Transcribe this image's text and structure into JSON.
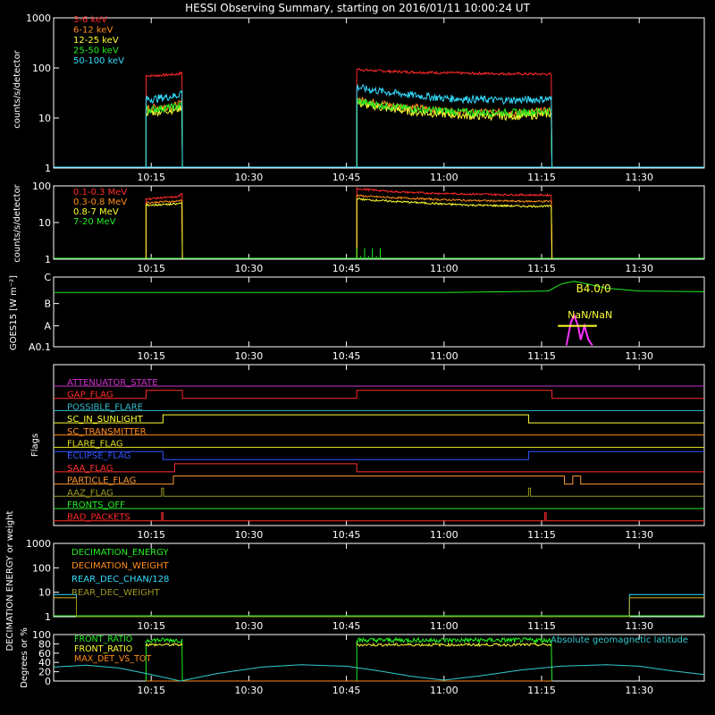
{
  "title": "HESSI Observing Summary, starting on 2016/01/11 10:00:24 UT",
  "x_tick_labels": [
    "10:15",
    "10:30",
    "10:45",
    "11:00",
    "11:15",
    "11:30"
  ],
  "chart_data": [
    {
      "type": "line",
      "ylabel": "counts/s/detector",
      "yscale": "log",
      "ylim": [
        1,
        1000
      ],
      "y_tick_labels": [
        "1",
        "10",
        "100",
        "1000"
      ],
      "x_unit": "minutes after 10:00 UT",
      "intervals": [
        [
          14.2,
          19.8
        ],
        [
          46.6,
          76.6
        ]
      ],
      "series": [
        {
          "name": "3-6 keV",
          "color": "#ff2a2a",
          "x": [
            14.2,
            15,
            17,
            19,
            19.8,
            46.6,
            48,
            52,
            56,
            60,
            64,
            68,
            72,
            76,
            76.6
          ],
          "y": [
            70,
            70,
            72,
            75,
            80,
            95,
            90,
            85,
            82,
            80,
            78,
            77,
            76,
            75,
            75
          ]
        },
        {
          "name": "6-12 keV",
          "color": "#ff8c1a",
          "x": [
            14.2,
            15,
            17,
            19,
            19.8,
            46.6,
            48,
            52,
            56,
            60,
            64,
            68,
            72,
            76,
            76.6
          ],
          "y": [
            16,
            16,
            17,
            18,
            21,
            24,
            22,
            18,
            16,
            14,
            13,
            13,
            13,
            14,
            14
          ]
        },
        {
          "name": "12-25 keV",
          "color": "#ffff33",
          "x": [
            14.2,
            15,
            17,
            19,
            19.8,
            46.6,
            48,
            52,
            56,
            60,
            64,
            68,
            72,
            76,
            76.6
          ],
          "y": [
            13,
            13,
            14,
            15,
            17,
            20,
            18,
            15,
            13,
            12,
            11,
            11,
            11,
            12,
            12
          ]
        },
        {
          "name": "25-50 keV",
          "color": "#22ee22",
          "x": [
            14.2,
            15,
            17,
            19,
            19.8,
            46.6,
            48,
            52,
            56,
            60,
            64,
            68,
            72,
            76,
            76.6
          ],
          "y": [
            15,
            15,
            16,
            17,
            19,
            22,
            20,
            17,
            15,
            14,
            13,
            13,
            13,
            14,
            14
          ]
        },
        {
          "name": "50-100 keV",
          "color": "#33ddff",
          "x": [
            14.2,
            15,
            17,
            19,
            19.8,
            46.6,
            48,
            52,
            56,
            60,
            64,
            68,
            72,
            76,
            76.6
          ],
          "y": [
            24,
            24,
            26,
            28,
            35,
            42,
            38,
            32,
            28,
            25,
            24,
            23,
            23,
            24,
            24
          ]
        }
      ]
    },
    {
      "type": "line",
      "ylabel": "counts/s/detector",
      "yscale": "log",
      "ylim": [
        1,
        100
      ],
      "y_tick_labels": [
        "1",
        "10",
        "100"
      ],
      "x_unit": "minutes after 10:00 UT",
      "intervals": [
        [
          14.2,
          19.8
        ],
        [
          46.6,
          76.6
        ]
      ],
      "series": [
        {
          "name": "0.1-0.3 MeV",
          "color": "#ff2a2a",
          "x": [
            14.2,
            15,
            17,
            19,
            19.8,
            46.6,
            48,
            52,
            56,
            60,
            64,
            68,
            72,
            76,
            76.6
          ],
          "y": [
            45,
            45,
            48,
            50,
            60,
            85,
            80,
            70,
            65,
            62,
            60,
            58,
            57,
            56,
            56
          ]
        },
        {
          "name": "0.3-0.8 MeV",
          "color": "#ff8c1a",
          "x": [
            14.2,
            15,
            17,
            19,
            19.8,
            46.6,
            48,
            52,
            56,
            60,
            64,
            68,
            72,
            76,
            76.6
          ],
          "y": [
            35,
            35,
            37,
            38,
            42,
            55,
            52,
            48,
            45,
            42,
            40,
            39,
            38,
            38,
            38
          ]
        },
        {
          "name": "0.8-7 MeV",
          "color": "#ffff33",
          "x": [
            14.2,
            15,
            17,
            19,
            19.8,
            46.6,
            48,
            52,
            56,
            60,
            64,
            68,
            72,
            76,
            76.6
          ],
          "y": [
            30,
            30,
            31,
            32,
            35,
            45,
            42,
            38,
            35,
            32,
            30,
            29,
            28,
            28,
            28
          ]
        },
        {
          "name": "7-20 MeV",
          "color": "#22ee22",
          "x": [
            46.6,
            47.2,
            47.8,
            48.4,
            49,
            49.6,
            50.2
          ],
          "y": [
            2,
            1.2,
            2,
            1.2,
            2,
            1.2,
            2
          ]
        }
      ]
    },
    {
      "type": "line",
      "ylabel": "GOES15 [W m⁻²]",
      "y_tick_labels": [
        "A0.1",
        "A",
        "B",
        "C"
      ],
      "x_unit": "minutes after 10:00 UT",
      "annotations": [
        "B4.0/0",
        "NaN/NaN"
      ],
      "series": [
        {
          "color": "#22ee22",
          "x": [
            0,
            10,
            20,
            30,
            40,
            50,
            60,
            70,
            76,
            78,
            80,
            82,
            85,
            90,
            100
          ],
          "y": [
            0.78,
            0.78,
            0.78,
            0.78,
            0.78,
            0.78,
            0.78,
            0.79,
            0.8,
            0.9,
            0.94,
            0.9,
            0.84,
            0.8,
            0.79
          ]
        },
        {
          "color": "#ff33ff",
          "x": [
            78.8,
            79.5,
            80,
            80.6,
            81,
            81.6,
            82.2,
            82.8
          ],
          "y": [
            0.02,
            0.35,
            0.45,
            0.3,
            0.1,
            0.3,
            0.1,
            0.02
          ]
        }
      ]
    },
    {
      "type": "line",
      "ylabel": "Flags",
      "x_unit": "minutes after 10:00 UT",
      "series": [
        {
          "name": "ATTENUATOR_STATE",
          "color": "#cc33cc",
          "x": [
            0,
            100
          ],
          "y": [
            0,
            0
          ]
        },
        {
          "name": "GAP_FLAG",
          "color": "#ff2a2a",
          "x": [
            0,
            14.2,
            14.2,
            19.8,
            19.8,
            46.6,
            46.6,
            76.6,
            76.6,
            100
          ],
          "y": [
            0,
            0,
            1,
            1,
            0,
            0,
            1,
            1,
            0,
            0
          ]
        },
        {
          "name": "POSSIBLE_FLARE",
          "color": "#33bbcc",
          "x": [
            0,
            100
          ],
          "y": [
            0,
            0
          ]
        },
        {
          "name": "SC_IN_SUNLIGHT",
          "color": "#ffff33",
          "x": [
            0,
            16.8,
            16.8,
            73,
            73,
            100
          ],
          "y": [
            0,
            0,
            1,
            1,
            0,
            0
          ]
        },
        {
          "name": "SC_TRANSMITTER",
          "color": "#ff8c1a",
          "x": [
            0,
            100
          ],
          "y": [
            0,
            0
          ]
        },
        {
          "name": "FLARE_FLAG",
          "color": "#dddd22",
          "x": [
            0,
            100
          ],
          "y": [
            0,
            0
          ]
        },
        {
          "name": "ECLIPSE_FLAG",
          "color": "#3355ff",
          "x": [
            0,
            16.8,
            16.8,
            73,
            73,
            100
          ],
          "y": [
            1,
            1,
            0,
            0,
            1,
            1
          ]
        },
        {
          "name": "SAA_FLAG",
          "color": "#ff3333",
          "x": [
            0,
            18.6,
            18.6,
            46.6,
            46.6,
            100
          ],
          "y": [
            0,
            0,
            1,
            1,
            0,
            0
          ]
        },
        {
          "name": "PARTICLE_FLAG",
          "color": "#ff9933",
          "x": [
            0,
            18.4,
            18.4,
            78.5,
            78.5,
            79.8,
            79.8,
            81,
            81,
            100
          ],
          "y": [
            0,
            0,
            1,
            1,
            0,
            0,
            1,
            1,
            0,
            0
          ]
        },
        {
          "name": "AAZ_FLAG",
          "color": "#999922",
          "x": [
            0,
            16.6,
            16.6,
            16.9,
            16.9,
            73,
            73,
            73.3,
            73.3,
            100
          ],
          "y": [
            0,
            0,
            1,
            1,
            0,
            0,
            1,
            1,
            0,
            0
          ]
        },
        {
          "name": "FRONTS_OFF",
          "color": "#22ee22",
          "x": [
            0,
            100
          ],
          "y": [
            0,
            0
          ]
        },
        {
          "name": "BAD_PACKETS",
          "color": "#ff2a2a",
          "x": [
            0,
            16.6,
            16.6,
            16.8,
            16.8,
            75.5,
            75.5,
            75.7,
            75.7,
            100
          ],
          "y": [
            0,
            0,
            1,
            1,
            0,
            0,
            1,
            1,
            0,
            0
          ]
        }
      ]
    },
    {
      "type": "line",
      "ylabel": "DECIMATION ENERGY or weight",
      "yscale": "log",
      "ylim": [
        1,
        1000
      ],
      "y_tick_labels": [
        "1",
        "10",
        "100",
        "1000"
      ],
      "x_unit": "minutes after 10:00 UT",
      "series": [
        {
          "name": "DECIMATION_ENERGY",
          "color": "#22ee22",
          "x": [
            0,
            100
          ],
          "y": [
            1,
            1
          ]
        },
        {
          "name": "DECIMATION_WEIGHT",
          "color": "#ff8c1a",
          "x": [
            0,
            3.5,
            3.5,
            88.5,
            88.5,
            100
          ],
          "y": [
            6,
            6,
            1,
            1,
            6,
            6
          ]
        },
        {
          "name": "REAR_DEC_CHAN/128",
          "color": "#33ddff",
          "x": [
            0,
            3.5,
            3.5,
            88.5,
            88.5,
            100
          ],
          "y": [
            8,
            8,
            1,
            1,
            8,
            8
          ]
        },
        {
          "name": "REAR_DEC_WEIGHT",
          "color": "#999922",
          "x": [
            0,
            3.5,
            3.5,
            88.5,
            88.5,
            100
          ],
          "y": [
            6,
            6,
            1,
            1,
            6,
            6
          ]
        }
      ]
    },
    {
      "type": "line",
      "ylabel": "Degrees or %",
      "ylim": [
        0,
        100
      ],
      "y_tick_labels": [
        "0",
        "20",
        "40",
        "60",
        "80",
        "100"
      ],
      "x_unit": "minutes after 10:00 UT",
      "annotations": [
        "Absolute geomagnetic latitude"
      ],
      "series": [
        {
          "name": "FRONT_RATIO",
          "color": "#22ee22",
          "x": [
            14.2,
            14.2,
            19.8,
            19.8,
            46.6,
            46.6,
            76.6,
            76.6
          ],
          "y": [
            0,
            92,
            92,
            0,
            0,
            88,
            88,
            0
          ]
        },
        {
          "name": "FRONT_RATIO",
          "color": "#ffff33",
          "x": [
            14.2,
            19.8,
            46.6,
            76.6
          ],
          "y": [
            80,
            82,
            78,
            78
          ]
        },
        {
          "name": "MAX_DET_VS_TOT",
          "color": "#ff8c1a",
          "x": [
            14.2,
            19.8,
            46.6,
            76.6
          ],
          "y": [
            0,
            0,
            0,
            0
          ]
        },
        {
          "color": "#33cccc",
          "x": [
            0,
            5,
            10,
            15,
            19.5,
            25,
            32,
            38,
            45,
            50,
            55,
            60,
            66,
            72,
            78,
            85,
            90,
            95,
            100
          ],
          "y": [
            30,
            34,
            28,
            14,
            0,
            16,
            30,
            35,
            32,
            22,
            10,
            2,
            12,
            24,
            32,
            35,
            32,
            22,
            14
          ]
        }
      ]
    }
  ]
}
